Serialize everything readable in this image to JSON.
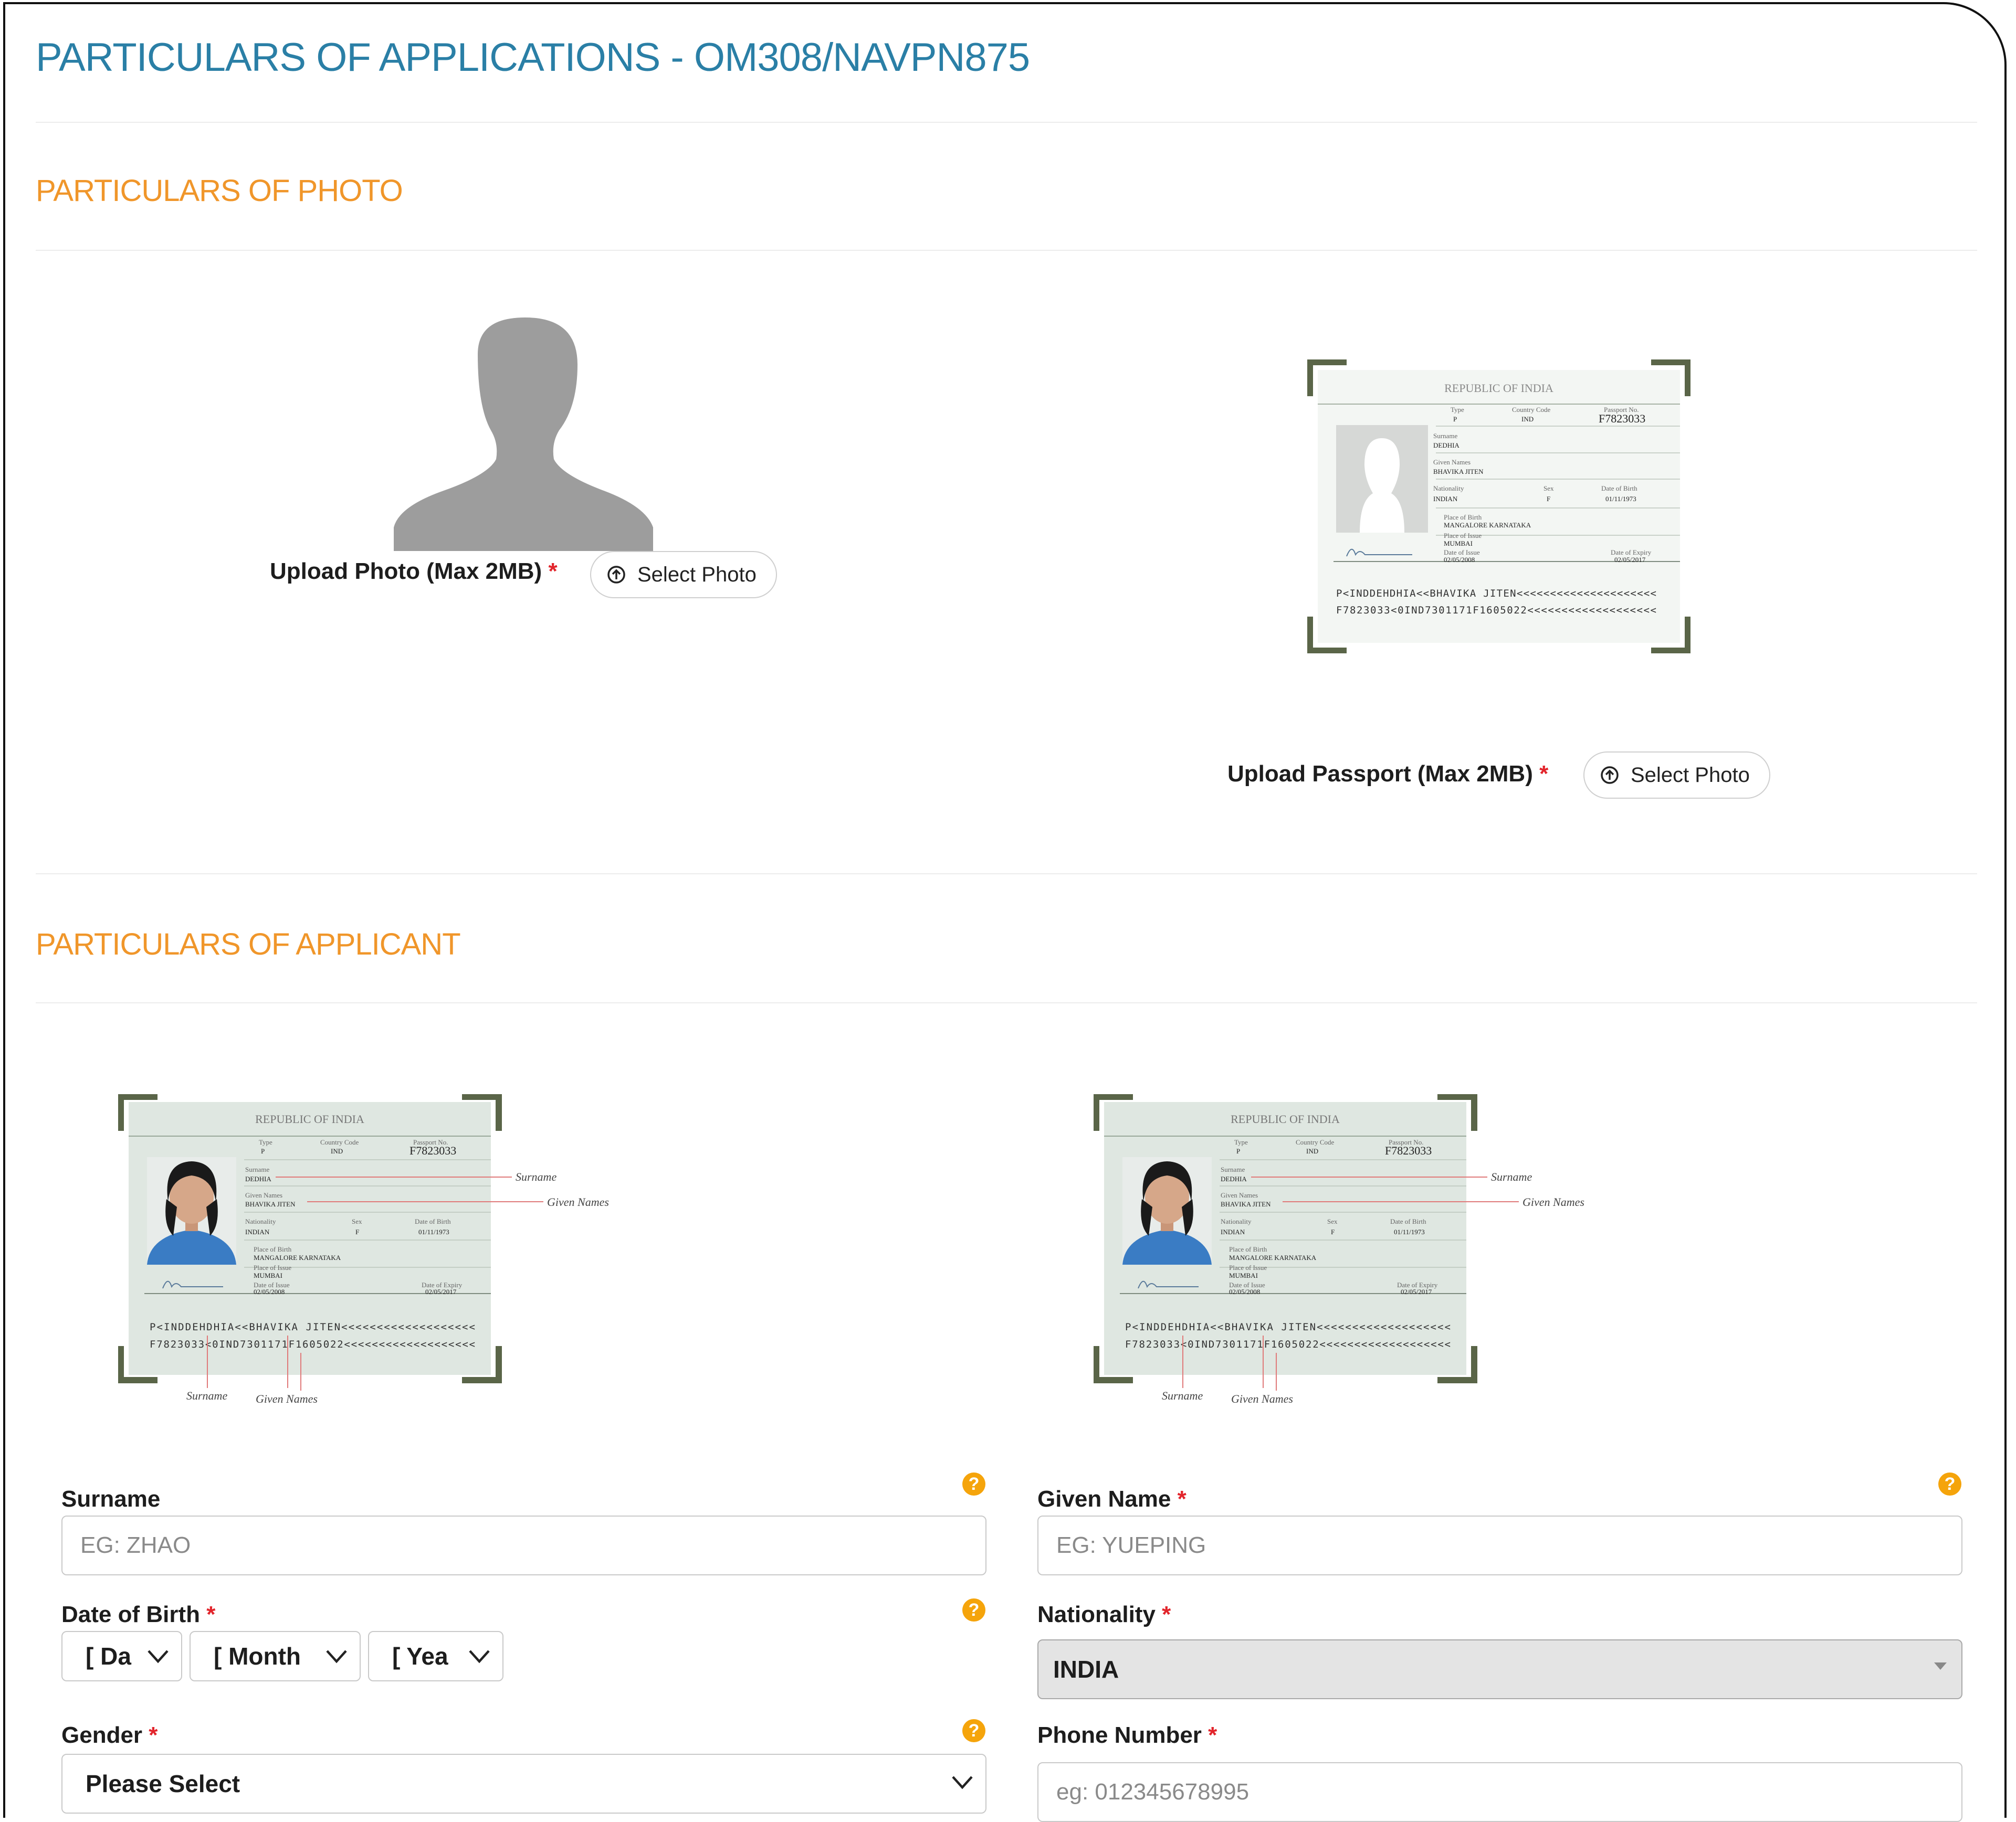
{
  "page": {
    "title": "PARTICULARS OF APPLICATIONS - OM308/NAVPN875"
  },
  "photo_section": {
    "title": "PARTICULARS OF PHOTO",
    "upload_photo_label": "Upload Photo (Max 2MB)",
    "upload_passport_label": "Upload Passport (Max 2MB)",
    "required_mark": "*",
    "select_photo_button": "Select Photo",
    "select_passport_button": "Select Photo"
  },
  "passport_sample": {
    "country": "REPUBLIC OF INDIA",
    "type_label": "Type",
    "type_value": "P",
    "country_code_label": "Country Code",
    "country_code_value": "IND",
    "passport_no_label": "Passport No.",
    "passport_no_value": "F7823033",
    "surname_label": "Surname",
    "surname_value": "DEDHIA",
    "given_names_label": "Given Names",
    "given_names_value": "BHAVIKA JITEN",
    "nationality_label": "Nationality",
    "nationality_value": "INDIAN",
    "sex_label": "Sex",
    "sex_value": "F",
    "dob_label": "Date of Birth",
    "dob_value": "01/11/1973",
    "pob_label": "Place of Birth",
    "pob_value": "MANGALORE KARNATAKA",
    "poi_label": "Place of Issue",
    "poi_value": "MUMBAI",
    "doi_label": "Date of Issue",
    "doi_value": "02/05/2008",
    "doe_label": "Date of Expiry",
    "doe_value": "02/05/2017",
    "mrz_line1": "P<INDDEHDHIA<<BHAVIKA JITEN<<<<<<<<<<<<<<<<<<<",
    "mrz_line2": "F7823033<0IND7301171F1605022<<<<<<<<<<<<<<<<<<<",
    "mrz_line1_passport": "P<INDDEHDHIA<<BHAVIKA JITEN<<<<<<<<<<<<<<<<<<<<<",
    "mrz_line2_passport": "F7823033<0IND7301171F1605022<<<<<<<<<<<<<<<<<<<",
    "annotation_surname": "Surname",
    "annotation_given_names": "Given Names"
  },
  "applicant_section": {
    "title": "PARTICULARS OF APPLICANT",
    "surname": {
      "label": "Surname",
      "placeholder": "EG: ZHAO"
    },
    "given_name": {
      "label": "Given Name",
      "placeholder": "EG: YUEPING"
    },
    "dob": {
      "label": "Date of Birth",
      "day": "[ Da",
      "month": "[ Month",
      "year": "[ Yea"
    },
    "nationality": {
      "label": "Nationality",
      "value": "INDIA"
    },
    "gender": {
      "label": "Gender",
      "value": "Please Select"
    },
    "phone": {
      "label": "Phone Number",
      "placeholder": "eg: 012345678995"
    },
    "required_mark": "*",
    "help_glyph": "?"
  },
  "colors": {
    "title_blue": "#2a7fa6",
    "section_orange": "#f0962a",
    "required_red": "#e2242b",
    "help_orange": "#f5a40b"
  }
}
